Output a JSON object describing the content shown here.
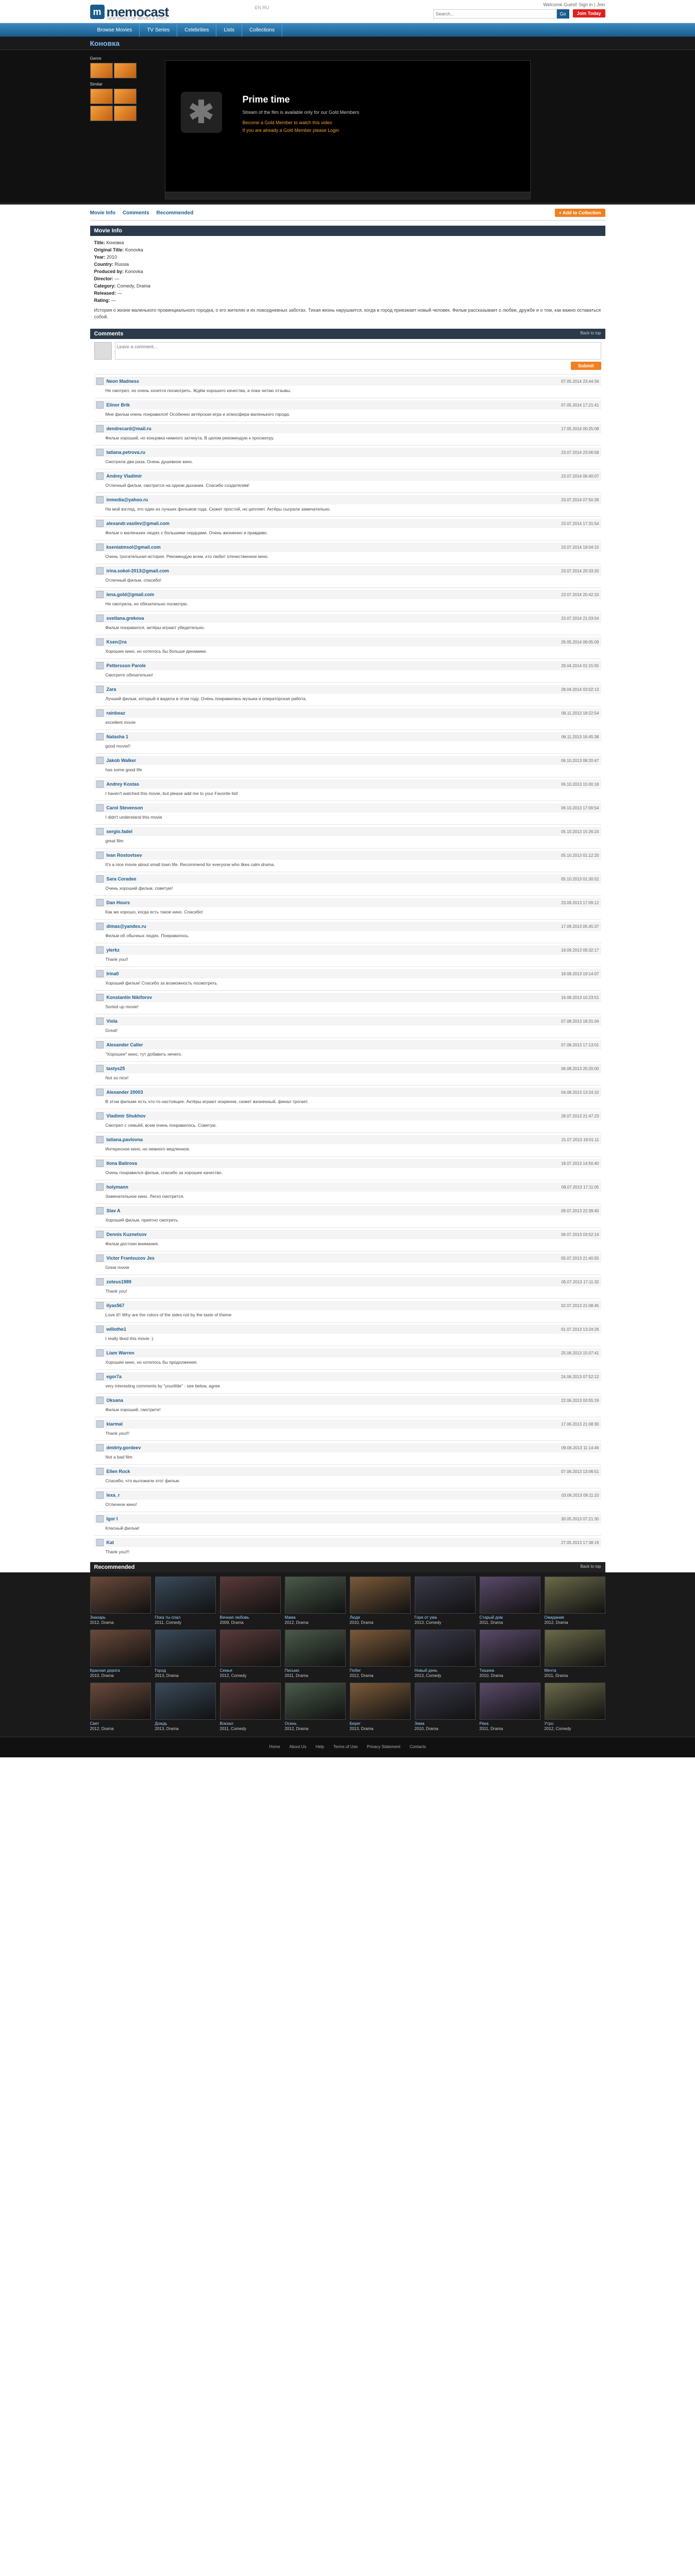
{
  "header": {
    "logo_text": "memocast",
    "logo_mark": "m",
    "tagline": "NEW WORLD OF MOVIES & VIDEO",
    "toplinks": "Welcome Guest! Sign in | Join",
    "lang": "EN  RU",
    "search_placeholder": "Search...",
    "search_go": "Go",
    "join_label": "Join Today"
  },
  "nav": {
    "items": [
      "Browse Movies",
      "TV Series",
      "Celebrities",
      "Lists",
      "Collections"
    ]
  },
  "page_title": "Коновка",
  "player": {
    "side_label_1": "Genre",
    "side_label_2": "Similar",
    "title": "Prime time",
    "line1": "Stream of the film is available only for our Gold Members",
    "line2": "Become a Gold Member to watch this video",
    "line3": "If you are already a Gold Member please Login"
  },
  "tabs": [
    "Movie Info",
    "Comments",
    "Recommended"
  ],
  "add_collection": "+ Add to Collection",
  "info": {
    "header": "Movie Info",
    "rows": [
      {
        "k": "Title:",
        "v": "Коновка"
      },
      {
        "k": "Original Title:",
        "v": "Konovka"
      },
      {
        "k": "Year:",
        "v": "2010"
      },
      {
        "k": "Country:",
        "v": "Russia"
      },
      {
        "k": "Produced by:",
        "v": "Konovka"
      },
      {
        "k": "Director:",
        "v": "—"
      },
      {
        "k": "Category:",
        "v": "Comedy, Drama"
      },
      {
        "k": "Released:",
        "v": "—"
      },
      {
        "k": "Rating:",
        "v": "—"
      }
    ],
    "about": "История о жизни маленького провинциального городка, о его жителях и их повседневных заботах. Тихая жизнь нарушается, когда в город приезжает новый человек. Фильм рассказывает о любви, дружбе и о том, как важно оставаться собой."
  },
  "comments_header": "Comments",
  "back_top": "Back to top",
  "comment_form": {
    "placeholder": "Leave a comment...",
    "submit": "Submit"
  },
  "comments": [
    {
      "name": "Neon Madness",
      "date": "07.05.2014 23:44:34",
      "text": "Не смотрел, но очень хочется посмотреть. Ждём хорошего качества, а пока читаю отзывы."
    },
    {
      "name": "Elinor Brik",
      "date": "07.05.2014 17:21:41",
      "text": "Мне фильм очень понравился! Особенно актёрская игра и атмосфера маленького города."
    },
    {
      "name": "dendrecard@mail.ru",
      "date": "17.05.2014 00:25:08",
      "text": "Фильм хороший, но концовка немного затянута. В целом рекомендую к просмотру."
    },
    {
      "name": "tatiana.petrova.ru",
      "date": "23.07.2014 23:06:58",
      "text": "Смотрела два раза. Очень душевное кино."
    },
    {
      "name": "Andrey Vladimir",
      "date": "23.07.2014 06:40:07",
      "text": "Отличный фильм, смотрится на одном дыхании. Спасибо создателям!"
    },
    {
      "name": "inmedia@yahoo.ru",
      "date": "23.07.2014 07:50:39",
      "text": "На мой взгляд, это один из лучших фильмов года. Сюжет простой, но цепляет. Актёры сыграли замечательно."
    },
    {
      "name": "alexandr.vasilev@gmail.com",
      "date": "23.07.2014 17:31:54",
      "text": "Фильм о маленьких людях с большими сердцами. Очень жизненно и правдиво."
    },
    {
      "name": "kseniatmsol@gmail.com",
      "date": "23.07.2014 19:04:15",
      "text": "Очень трогательная история. Рекомендую всем, кто любит отечественное кино."
    },
    {
      "name": "irina.sokol-2013@gmail.com",
      "date": "23.07.2014 20:33:20",
      "text": "Отличный фильм, спасибо!"
    },
    {
      "name": "lena.gold@gmail.com",
      "date": "23.07.2014 20:42:10",
      "text": "Не смотрела, но обязательно посмотрю."
    },
    {
      "name": "svetlana.grekova",
      "date": "23.07.2014 21:03:54",
      "text": "Фильм понравился, актёры играют убедительно."
    },
    {
      "name": "Ksen@ra",
      "date": "26.05.2014 06:05:09",
      "text": "Хорошее кино, но хотелось бы больше динамики."
    },
    {
      "name": "Pettersson Parole",
      "date": "29.04.2014 01:15:55",
      "text": "Смотрите обязательно!"
    },
    {
      "name": "Zara",
      "date": "28.04.2014 03:02:13",
      "text": "Лучший фильм, который я видела в этом году. Очень понравилась музыка и операторская работа."
    },
    {
      "name": "rainbeaz",
      "date": "06.11.2013 18:22:54",
      "text": "excellent movie"
    },
    {
      "name": "Natasha 1",
      "date": "06.11.2013 16:45:38",
      "text": "good movie!!"
    },
    {
      "name": "Jakob Walker",
      "date": "06.10.2013 08:20:47",
      "text": "has some good life"
    },
    {
      "name": "Andrey Kostas",
      "date": "06.10.2013 15:00:18",
      "text": "I haven't watched this movie, but please add me to your Favorite list!"
    },
    {
      "name": "Carol Stevenson",
      "date": "06.10.2013 17:00:54",
      "text": "I didn't understand this movie"
    },
    {
      "name": "sergio.fadel",
      "date": "05.10.2013 15:26:24",
      "text": "great film"
    },
    {
      "name": "Ivan Rostovtsev",
      "date": "05.10.2013 01:12:20",
      "text": "It's a nice movie about small town life. Recommend for everyone who likes calm drama."
    },
    {
      "name": "Sara Coradee",
      "date": "05.10.2013 01:30:52",
      "text": "Очень хороший фильм, советую!"
    },
    {
      "name": "Dan Hours",
      "date": "23.09.2013 17:09:12",
      "text": "Как же хорошо, когда есть такое кино. Спасибо!"
    },
    {
      "name": "dimas@yandex.ru",
      "date": "17.09.2013 05:45:37",
      "text": "Фильм об обычных людях. Понравилось."
    },
    {
      "name": "ylerkz",
      "date": "19.09.2013 09:32:17",
      "text": "Thank you!!"
    },
    {
      "name": "Irina0",
      "date": "18.08.2013 19:14:07",
      "text": "Хороший фильм! Спасибо за возможность посмотреть."
    },
    {
      "name": "Konstantin Nikiforov",
      "date": "16.08.2013 10:23:51",
      "text": "Sorted up movie!"
    },
    {
      "name": "Viola",
      "date": "07.08.2013 18:31:04",
      "text": "Great!"
    },
    {
      "name": "Alexander Caller",
      "date": "07.08.2013 17:13:01",
      "text": "\"Хорошее\" кино, тут добавить нечего."
    },
    {
      "name": "tastys25",
      "date": "06.08.2013 20:20:00",
      "text": "Not so nice!"
    },
    {
      "name": "Alexander 20003",
      "date": "04.08.2013 13:24:10",
      "text": "В этом фильме есть что-то настоящее. Актёры играют искренне, сюжет жизненный, финал трогает."
    },
    {
      "name": "Vladimir Shukhov",
      "date": "28.07.2013 21:47:23",
      "text": "Смотрел с семьёй, всем очень понравилось. Советую."
    },
    {
      "name": "tatiana.pavlovna",
      "date": "21.07.2013 19:01:11",
      "text": "Интересное кино, но немного медленное."
    },
    {
      "name": "Ilona Batirova",
      "date": "18.07.2013 14:50:40",
      "text": "Очень понравился фильм, спасибо за хорошее качество."
    },
    {
      "name": "holymann",
      "date": "09.07.2013 17:11:05",
      "text": "Замечательное кино. Легко смотрится."
    },
    {
      "name": "Slav A",
      "date": "09.07.2013 22:39:40",
      "text": "Хороший фильм, приятно смотреть."
    },
    {
      "name": "Dennis Kuznetsov",
      "date": "06.07.2013 03:52:14",
      "text": "Фильм достоин внимания."
    },
    {
      "name": "Victor Frantsuzov Jes",
      "date": "05.07.2013 21:40:55",
      "text": "Great movie"
    },
    {
      "name": "zoteus1989",
      "date": "05.07.2013 17:11:32",
      "text": "Thank you!"
    },
    {
      "name": "ilyas567",
      "date": "02.07.2013 21:08:45",
      "text": "Love it!! Why are the colors of the sides not by the taste of theme"
    },
    {
      "name": "willothe1",
      "date": "01.07.2013 13:24:26",
      "text": "I really liked this movie :)"
    },
    {
      "name": "Liam Warren",
      "date": "25.06.2013 15:07:41",
      "text": "Хорошее кино, но хотелось бы продолжения."
    },
    {
      "name": "egor7a",
      "date": "24.06.2013 07:52:12",
      "text": "very interesting comments by \"yourlittle\" - see below, agree"
    },
    {
      "name": "Oksana",
      "date": "22.06.2013 03:55:19",
      "text": "Фильм хороший, смотрите!"
    },
    {
      "name": "kiarmal",
      "date": "17.06.2013 21:08:30",
      "text": "Thank you!!!"
    },
    {
      "name": "dmitriy.gordeev",
      "date": "09.06.2013 11:14:46",
      "text": "Not a bad film"
    },
    {
      "name": "Ellen Rock",
      "date": "07.06.2013 13:06:51",
      "text": "Спасибо, что выложили этот фильм."
    },
    {
      "name": "lexa_r",
      "date": "03.06.2013 09:11:10",
      "text": "Отличное кино!"
    },
    {
      "name": "Igor I",
      "date": "30.05.2013 07:21:30",
      "text": "Класный фильм!"
    },
    {
      "name": "Kat",
      "date": "27.05.2013 17:38:19",
      "text": "Thank you!!!"
    }
  ],
  "recommend": {
    "header": "Recommended",
    "back": "Back to top",
    "items": [
      {
        "title": "Знахарь",
        "sub": "2012, Drama"
      },
      {
        "title": "Пока ты спал",
        "sub": "2011, Comedy"
      },
      {
        "title": "Вечная любовь",
        "sub": "2009, Drama"
      },
      {
        "title": "Мама",
        "sub": "2012, Drama"
      },
      {
        "title": "Люди",
        "sub": "2010, Drama"
      },
      {
        "title": "Горе от ума",
        "sub": "2013, Comedy"
      },
      {
        "title": "Старый дом",
        "sub": "2011, Drama"
      },
      {
        "title": "Ожидание",
        "sub": "2012, Drama"
      },
      {
        "title": "Красная дорога",
        "sub": "2010, Drama"
      },
      {
        "title": "Город",
        "sub": "2013, Drama"
      },
      {
        "title": "Семья",
        "sub": "2012, Comedy"
      },
      {
        "title": "Письмо",
        "sub": "2011, Drama"
      },
      {
        "title": "Побег",
        "sub": "2012, Drama"
      },
      {
        "title": "Новый день",
        "sub": "2013, Comedy"
      },
      {
        "title": "Тишина",
        "sub": "2010, Drama"
      },
      {
        "title": "Мечта",
        "sub": "2011, Drama"
      },
      {
        "title": "Свет",
        "sub": "2012, Drama"
      },
      {
        "title": "Дождь",
        "sub": "2013, Drama"
      },
      {
        "title": "Вокзал",
        "sub": "2011, Comedy"
      },
      {
        "title": "Осень",
        "sub": "2012, Drama"
      },
      {
        "title": "Берег",
        "sub": "2013, Drama"
      },
      {
        "title": "Зима",
        "sub": "2010, Drama"
      },
      {
        "title": "Река",
        "sub": "2011, Drama"
      },
      {
        "title": "Утро",
        "sub": "2012, Comedy"
      }
    ]
  },
  "footer": {
    "links": [
      "Home",
      "About Us",
      "Help",
      "Terms of Use",
      "Privacy Statement",
      "Contacts"
    ]
  },
  "colors": {
    "accent": "#1a5c8c",
    "orange": "#f08020",
    "join": "#e02020"
  }
}
